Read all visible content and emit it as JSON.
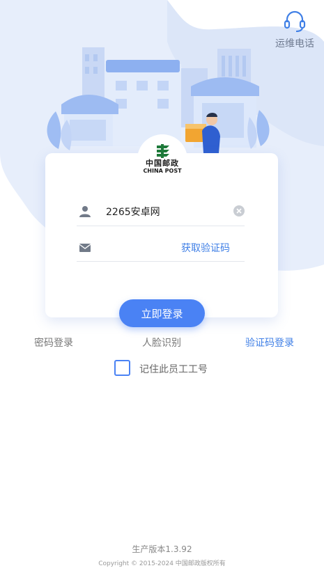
{
  "header": {
    "support_label": "运维电话"
  },
  "logo": {
    "name_cn": "中国邮政",
    "name_en": "CHINA POST"
  },
  "form": {
    "username_value": "2265安卓网",
    "code_value": "",
    "get_code_label": "获取验证码",
    "login_label": "立即登录"
  },
  "tabs": [
    {
      "label": "密码登录",
      "active": false
    },
    {
      "label": "人脸识别",
      "active": false
    },
    {
      "label": "验证码登录",
      "active": true
    }
  ],
  "remember": {
    "label": "记住此员工工号",
    "checked": false
  },
  "footer": {
    "version": "生产版本1.3.92",
    "copyright": "Copyright © 2015-2024 中国邮政版权所有"
  },
  "colors": {
    "accent": "#4a82f4",
    "link": "#3f7fe6",
    "brand_green": "#1e7a3a"
  }
}
